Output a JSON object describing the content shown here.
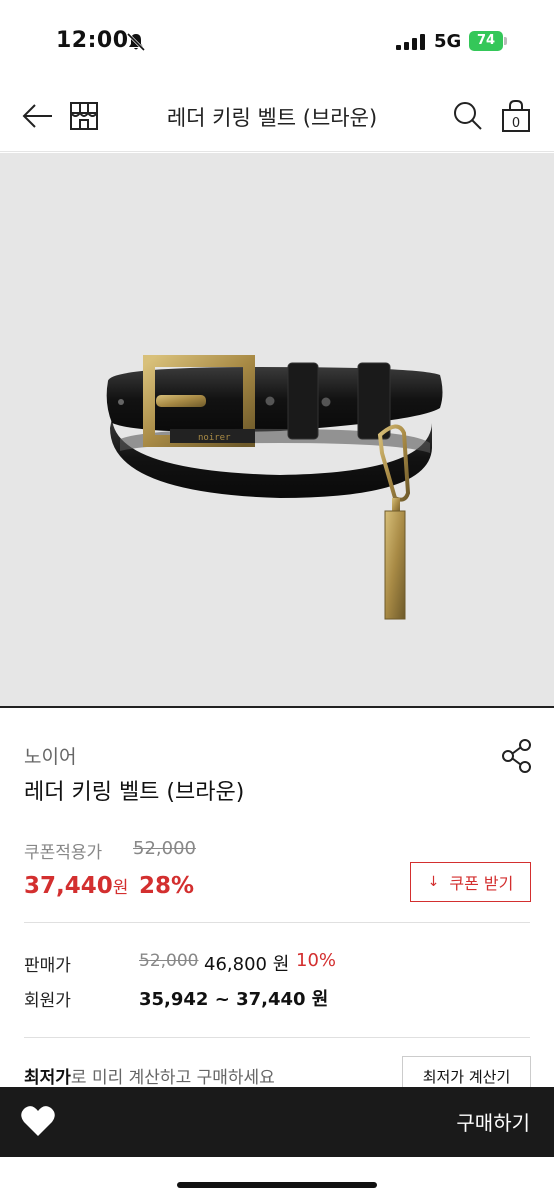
{
  "status_bar": {
    "time": "12:00",
    "network": "5G",
    "battery": "74"
  },
  "nav": {
    "title": "레더 키링 벨트 (브라운)"
  },
  "product": {
    "brand": "노이어",
    "name": "레더 키링 벨트 (브라운)",
    "belt_engraving": "noirer"
  },
  "pricing": {
    "coupon_label": "쿠폰적용가",
    "original_price": "52,000",
    "sale_price": "37,440",
    "currency_unit": "원",
    "discount_rate": "28%",
    "coupon_button": "쿠폰 받기",
    "sell_label": "판매가",
    "sell_original": "52,000",
    "sell_price": "46,800 원",
    "sell_discount": "10%",
    "member_label": "회원가",
    "member_price": "35,942 ~ 37,440 원"
  },
  "lowest": {
    "bold_part": "최저가",
    "rest": "로 미리 계산하고 구매하세요",
    "button": "최저가 계산기"
  },
  "bottom_bar": {
    "buy_label": "구매하기"
  },
  "colors": {
    "accent": "#d32f2f",
    "battery": "#34c759",
    "bottom_bar": "#1a1a1a",
    "image_bg": "#e6e6e6"
  }
}
